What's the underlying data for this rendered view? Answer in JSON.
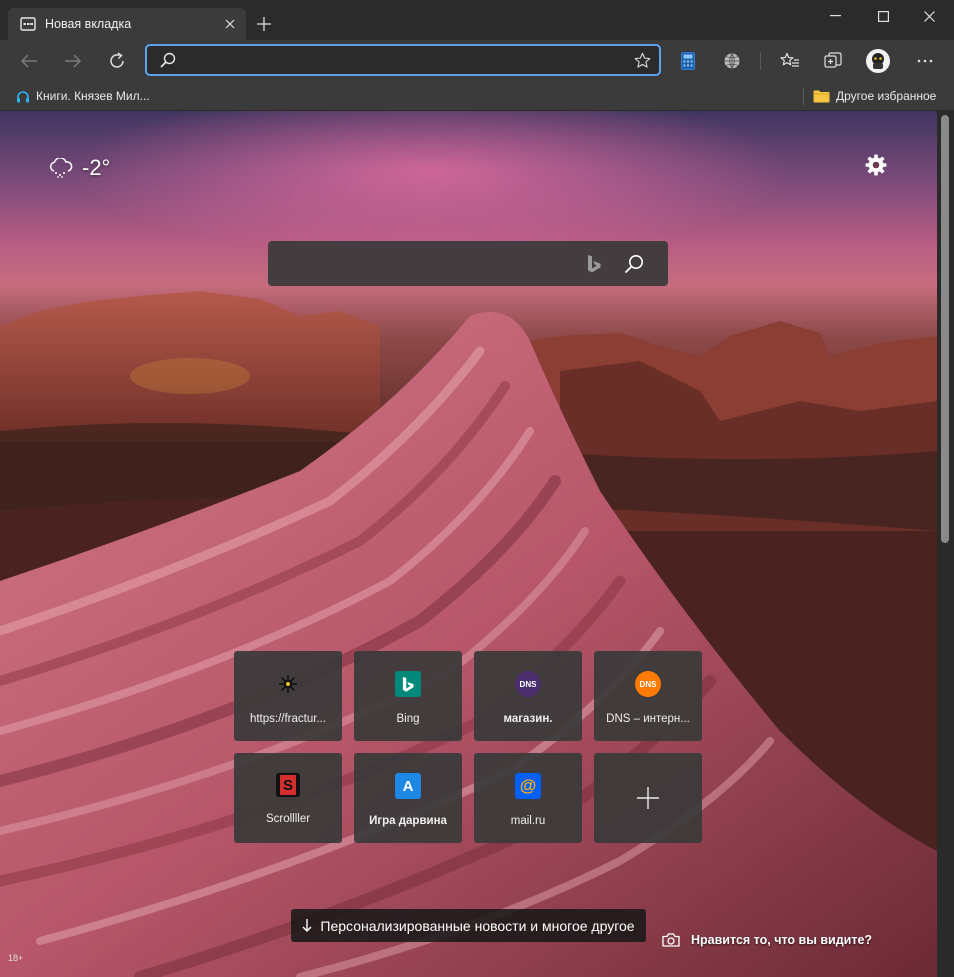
{
  "tab": {
    "title": "Новая вкладка"
  },
  "address_bar": {
    "value": "",
    "placeholder": ""
  },
  "bookmarks": {
    "items": [
      {
        "label": "Книги. Князев Мил..."
      }
    ],
    "other_favorites": "Другое избранное"
  },
  "weather": {
    "temperature": "-2°",
    "icon": "snow-cloud-icon"
  },
  "search": {
    "placeholder": ""
  },
  "tiles": [
    {
      "label": "https://fractur...",
      "icon_text": "",
      "icon_bg": "#3a3a3a",
      "bold": false
    },
    {
      "label": "Bing",
      "icon_text": "b",
      "icon_bg": "#00897b",
      "bold": false
    },
    {
      "label": "магазин.",
      "icon_text": "DNS",
      "icon_bg": "#4a2e6e",
      "bold": true
    },
    {
      "label": "DNS – интерн...",
      "icon_text": "DNS",
      "icon_bg": "#ff7a00",
      "bold": false
    },
    {
      "label": "Scrollller",
      "icon_text": "S",
      "icon_bg": "#d32f2f",
      "bold": false
    },
    {
      "label": "Игра дарвина",
      "icon_text": "A",
      "icon_bg": "#1e88e5",
      "bold": true
    },
    {
      "label": "mail.ru",
      "icon_text": "@",
      "icon_bg": "#005ff9",
      "bold": false
    }
  ],
  "news_button": {
    "label": "Персонализированные новости и многое другое"
  },
  "feedback_link": {
    "label": "Нравится то, что вы видите?"
  },
  "age_badge": "18+",
  "colors": {
    "accent": "#5da2f0",
    "toolbar": "#3b3b3b",
    "titlebar": "#2b2b2b"
  }
}
